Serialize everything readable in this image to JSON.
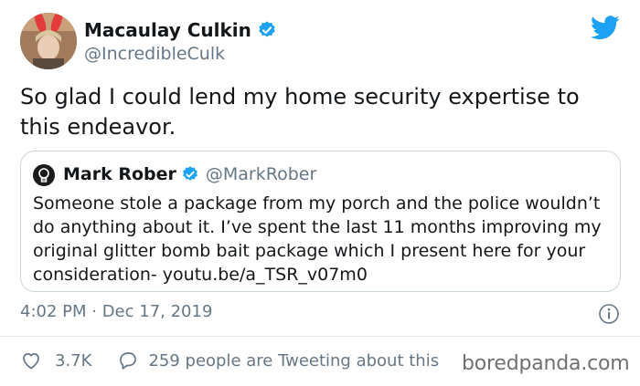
{
  "author": {
    "display_name": "Macaulay Culkin",
    "handle": "@IncredibleCulk",
    "avatar_icon": "avatar-bunny-ears",
    "verified_icon": "verified-badge-icon"
  },
  "tweet": {
    "text": "So glad I could lend my home security expertise to this endeavor."
  },
  "quoted_tweet": {
    "display_name": "Mark Rober",
    "handle": "@MarkRober",
    "avatar_icon": "lightbulb-avatar",
    "text": "Someone stole a package from my porch and the police wouldn’t do anything about it.  I’ve spent the last 11 months improving my original glitter bomb bait package which I present here for your consideration- youtu.be/a_TSR_v07m0"
  },
  "meta": {
    "timestamp": "4:02 PM · Dec 17, 2019"
  },
  "engagement": {
    "likes": "3.7K",
    "conversation": "259 people are Tweeting about this"
  },
  "watermark": "boredpanda.com",
  "colors": {
    "twitter_blue": "#1da1f2",
    "text_primary": "#14171a",
    "text_secondary": "#657786",
    "border": "#ccd6dd"
  }
}
